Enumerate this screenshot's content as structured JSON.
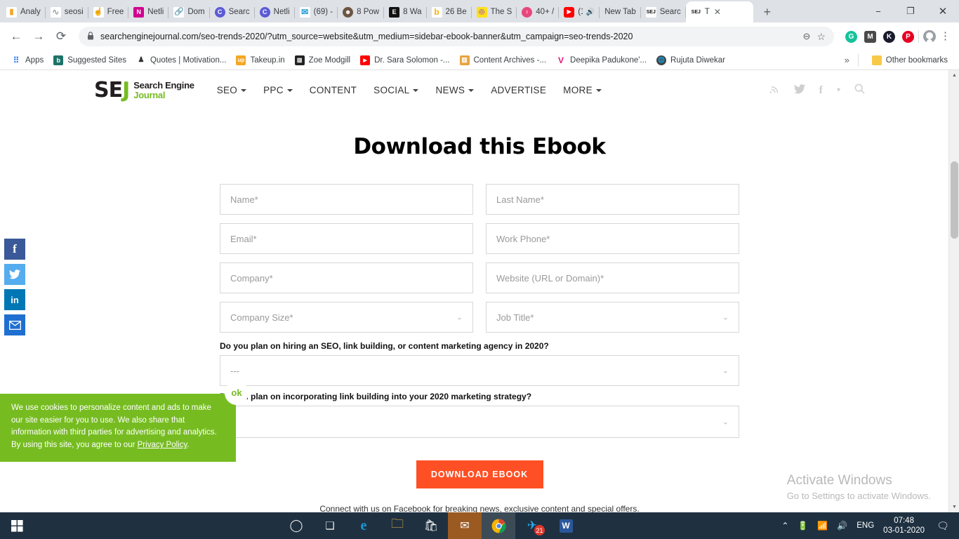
{
  "browser": {
    "tabs": [
      {
        "label": "Analy",
        "icon": "bar-chart-icon",
        "icon_color": "#f5a623",
        "icon_text": "▮"
      },
      {
        "label": "seosi",
        "icon": "pulse-icon",
        "icon_color": "#9aa0a6",
        "icon_text": "∿"
      },
      {
        "label": "Free",
        "icon": "hand-cursor-icon",
        "icon_color": "#1a73e8",
        "icon_text": "☝"
      },
      {
        "label": "Netli",
        "icon": "onenote-icon",
        "icon_color": "#d1008f",
        "icon_text": "N"
      },
      {
        "label": "Dom",
        "icon": "link-icon",
        "icon_color": "#4a90e2",
        "icon_text": "🔗"
      },
      {
        "label": "Searc",
        "icon": "cortana-circle-icon",
        "icon_color": "#5b5bd6",
        "icon_text": "C"
      },
      {
        "label": "Netli",
        "icon": "cortana-circle-icon",
        "icon_color": "#5b5bd6",
        "icon_text": "C"
      },
      {
        "label": "(69) -",
        "icon": "mail-envelope-icon",
        "icon_color": "#1a9ad6",
        "icon_text": "✉"
      },
      {
        "label": "8 Pow",
        "icon": "face-avatar-icon",
        "icon_color": "#6d5543",
        "icon_text": "☻"
      },
      {
        "label": "8 Wa",
        "icon": "e-letter-icon",
        "icon_color": "#111111",
        "icon_text": "E"
      },
      {
        "label": "26 Be",
        "icon": "b-letter-icon",
        "icon_color": "#f7b500",
        "icon_text": "b"
      },
      {
        "label": "The S",
        "icon": "mailchimp-icon",
        "icon_color": "#ffe01b",
        "icon_text": "🐵"
      },
      {
        "label": "40+ /",
        "icon": "pinterest-pin-icon",
        "icon_color": "#e8467c",
        "icon_text": "♀"
      },
      {
        "label": "(1",
        "icon": "youtube-icon",
        "icon_color": "#ff0000",
        "icon_text": "▶"
      },
      {
        "label": "New Tab",
        "icon": "blank-page-icon",
        "icon_color": "transparent",
        "icon_text": ""
      },
      {
        "label": "Searc",
        "icon": "sej-favicon",
        "icon_color": "#ffffff",
        "icon_text": "SEJ"
      },
      {
        "label": "T",
        "icon": "sej-favicon",
        "icon_color": "#ffffff",
        "icon_text": "SEJ",
        "active": true
      }
    ],
    "tab_close_glyph": "✕",
    "new_tab_glyph": "+",
    "window_controls": {
      "minimize": "−",
      "maximize": "❐",
      "close": "✕"
    },
    "toolbar": {
      "back": "←",
      "forward": "→",
      "reload": "⟳",
      "lock_icon": "🔒",
      "url": "searchenginejournal.com/seo-trends-2020/?utm_source=website&utm_medium=sidebar-ebook-banner&utm_campaign=seo-trends-2020",
      "zoom_out_icon": "⊖",
      "bookmark_star": "☆",
      "extensions": [
        {
          "name": "grammarly-extension",
          "letter": "G",
          "color": "#15c39a"
        },
        {
          "name": "mailtrack-extension",
          "letter": "M",
          "color": "#4a4a4a"
        },
        {
          "name": "kissmetrics-extension",
          "letter": "K",
          "color": "#1a1a2e"
        },
        {
          "name": "pinterest-extension",
          "letter": "P",
          "color": "#e60023"
        }
      ],
      "menu_glyph": "⋮"
    },
    "bookmarks": {
      "apps_label": "Apps",
      "items": [
        {
          "label": "Suggested Sites",
          "icon_letter": "b",
          "icon_color": "#1d7268"
        },
        {
          "label": "Quotes | Motivation...",
          "icon_letter": "♟",
          "icon_color": "#ffffff"
        },
        {
          "label": "Takeup.in",
          "icon_letter": "up",
          "icon_color": "#f5a623"
        },
        {
          "label": "Zoe Modgill",
          "icon_letter": "▥",
          "icon_color": "#222222"
        },
        {
          "label": "Dr. Sara Solomon -...",
          "icon_letter": "▶",
          "icon_color": "#ff0000"
        },
        {
          "label": "Content Archives -...",
          "icon_letter": "▤",
          "icon_color": "#e8a33d"
        },
        {
          "label": "Deepika Padukone'...",
          "icon_letter": "V",
          "icon_color": "#e8147b"
        },
        {
          "label": "Rujuta Diwekar",
          "icon_letter": "🌐",
          "icon_color": "#444444"
        }
      ],
      "overflow_glyph": "»",
      "other_bookmarks_label": "Other bookmarks",
      "other_bookmarks_icon_color": "#f7c948"
    }
  },
  "site": {
    "logo": {
      "mark": "SE",
      "mark_accent": "J",
      "line1": "Search Engine",
      "line2": "Journal",
      "registered": "®"
    },
    "nav": [
      {
        "label": "SEO",
        "has_caret": true
      },
      {
        "label": "PPC",
        "has_caret": true
      },
      {
        "label": "CONTENT",
        "has_caret": false
      },
      {
        "label": "SOCIAL",
        "has_caret": true
      },
      {
        "label": "NEWS",
        "has_caret": true
      },
      {
        "label": "ADVERTISE",
        "has_caret": false
      },
      {
        "label": "MORE",
        "has_caret": true
      }
    ],
    "header_icons": [
      {
        "name": "rss-icon",
        "glyph": "📶"
      },
      {
        "name": "twitter-icon",
        "glyph": "🐦"
      },
      {
        "name": "facebook-icon",
        "glyph": "f"
      },
      {
        "name": "chevron-down-icon",
        "glyph": "▾"
      },
      {
        "name": "search-icon",
        "glyph": "🔍"
      }
    ],
    "social_rail": [
      {
        "name": "facebook-share-button",
        "glyph": "f",
        "color": "#3b5998"
      },
      {
        "name": "twitter-share-button",
        "glyph": "🐦",
        "color": "#55acee"
      },
      {
        "name": "linkedin-share-button",
        "glyph": "in",
        "color": "#0077b5"
      },
      {
        "name": "email-share-button",
        "glyph": "✉",
        "color": "#1f6fd0"
      }
    ]
  },
  "form": {
    "title": "Download this Ebook",
    "fields": {
      "name": "Name*",
      "last_name": "Last Name*",
      "email": "Email*",
      "work_phone": "Work Phone*",
      "company": "Company*",
      "website": "Website (URL or Domain)*",
      "company_size": "Company Size*",
      "job_title": "Job Title*"
    },
    "question1": {
      "label": "Do you plan on hiring an SEO, link building, or content marketing agency in 2020?",
      "value": "---"
    },
    "question2": {
      "label": "Do you plan on incorporating link building into your 2020 marketing strategy?",
      "value": ""
    },
    "select_caret": "⌄",
    "submit_label": "DOWNLOAD EBOOK",
    "footnote": "Connect with us on Facebook for breaking news, exclusive content and special offers."
  },
  "cookie_banner": {
    "text": "We use cookies to personalize content and ads to make our site easier for you to use. We also share that information with third parties for advertising and analytics. By using this site, you agree to our ",
    "link_label": "Privacy Policy",
    "period": ".",
    "ok_label": "ok",
    "bg_color": "#76bc21"
  },
  "watermark": {
    "line1": "Activate Windows",
    "line2": "Go to Settings to activate Windows."
  },
  "taskbar": {
    "start_glyph": "⊞",
    "items": [
      {
        "name": "cortana-button",
        "glyph": "◯"
      },
      {
        "name": "task-view-button",
        "glyph": "❏"
      },
      {
        "name": "edge-taskbar-icon",
        "glyph": "e",
        "color": "#1a9ad6"
      },
      {
        "name": "file-explorer-taskbar-icon",
        "glyph": "🗀",
        "color": "#f5b942"
      },
      {
        "name": "microsoft-store-taskbar-icon",
        "glyph": "🛍",
        "color": "#ffffff"
      },
      {
        "name": "mail-taskbar-icon",
        "glyph": "✉",
        "color": "#ffffff"
      },
      {
        "name": "chrome-taskbar-icon",
        "glyph": "◉",
        "color": "#4285f4"
      },
      {
        "name": "telegram-taskbar-icon",
        "glyph": "✈",
        "color": "#2aabee",
        "badge": "21"
      },
      {
        "name": "word-taskbar-icon",
        "glyph": "W",
        "color": "#2b579a"
      }
    ],
    "tray": {
      "chevron": "⌃",
      "battery_icon": "🔋",
      "wifi_icon": "📶",
      "volume_icon": "🔊",
      "language": "ENG",
      "time": "07:48",
      "date": "03-01-2020",
      "action_center": "🗨"
    }
  }
}
